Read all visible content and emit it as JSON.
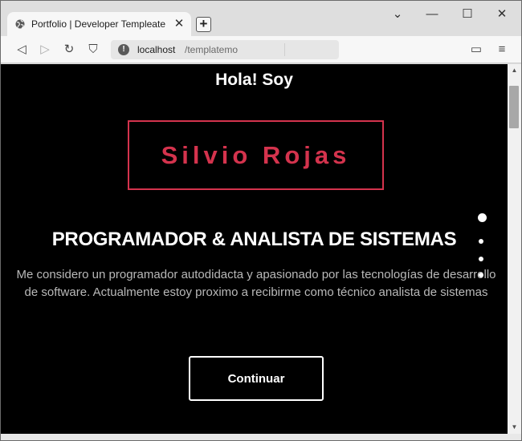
{
  "browser": {
    "tab_title": "Portfolio | Developer Templeate",
    "tab_close": "✕",
    "new_tab": "+",
    "window_controls": {
      "minimize": "—",
      "maximize": "☐",
      "close": "✕",
      "dropdown": "⌄"
    },
    "address_host": "localhost",
    "address_path": "/templatemo",
    "info_glyph": "!",
    "toolbar_glyphs": {
      "back": "◁",
      "forward": "▷",
      "reload": "↻",
      "bookmark": "⛉",
      "wallet": "▭",
      "menu": "≡"
    }
  },
  "page": {
    "greeting": "Hola! Soy",
    "name": "Silvio Rojas",
    "headline": "PROGRAMADOR & ANALISTA DE SISTEMAS",
    "description": "Me considero un programador autodidacta y apasionado por las tecnologías de desarrollo de software. Actualmente estoy proximo a recibirme como técnico analista de sistemas",
    "cta_label": "Continuar",
    "section_dots": [
      true,
      false,
      false,
      false
    ]
  },
  "scrollbar": {
    "up": "▲",
    "down": "▼"
  },
  "colors": {
    "accent": "#d4334d",
    "background": "#000000",
    "text": "#ffffff",
    "muted_text": "#b9b9b9"
  }
}
